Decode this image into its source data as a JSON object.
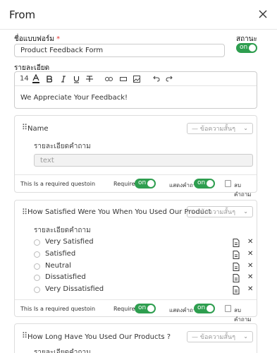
{
  "header": {
    "title": "From"
  },
  "form": {
    "name_label": "ชื่อแบบฟอร์ม",
    "name_required_mark": "*",
    "name_value": "Product Feedback Form",
    "status_label": "สถานะ",
    "status_toggle": "on",
    "description_label": "รายละเอียด",
    "editor": {
      "font_size": "14",
      "text": "We Appreciate Your Feedback!"
    }
  },
  "questions": [
    {
      "title": "Name",
      "type_placeholder": "— ข้อความสั้นๆ",
      "detail_label": "รายละเอียดคำถาม",
      "answer_placeholder": "text",
      "footer": {
        "required_text": "This Is a required questoin",
        "require_label": "Require",
        "require_toggle": "on",
        "show_label": "แสดงคำถาม",
        "show_toggle": "on",
        "delete_label": "ลบคำถาม"
      }
    },
    {
      "title": "How Satisfied Were You When You Used Our Product",
      "type_placeholder": "— ข้อความสั้นๆ",
      "detail_label": "รายละเอียดคำถาม",
      "options": [
        "Very Satisfied",
        "Satisfied",
        "Neutral",
        "Dissatisfied",
        "Very Dissatisfied"
      ],
      "footer": {
        "required_text": "This Is a required questoin",
        "require_label": "Require",
        "require_toggle": "on",
        "show_label": "แสดงคำถาม",
        "show_toggle": "on",
        "delete_label": "ลบคำถาม"
      }
    },
    {
      "title": "How  Long Have You Used Our Products ?",
      "type_placeholder": "— ข้อความสั้นๆ",
      "detail_label": "รายละเอียดคำถาม"
    }
  ],
  "colors": {
    "accent": "#2e9e4f",
    "required": "#e53935"
  }
}
